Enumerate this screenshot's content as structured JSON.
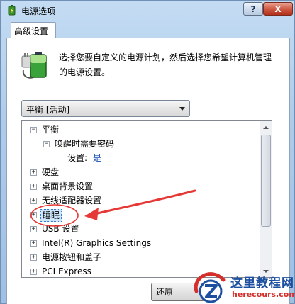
{
  "window": {
    "title": "电源选项",
    "help_label": "?",
    "close_label": "X"
  },
  "tabs": [
    {
      "label": "高级设置"
    }
  ],
  "description": "选择您要自定义的电源计划，然后选择您希望计算机管理的电源设置。",
  "plan_select": {
    "selected": "平衡 [活动]"
  },
  "tree": {
    "rows": [
      {
        "expander": "−",
        "label": "平衡"
      },
      {
        "expander": "−",
        "label": "唤醒时需要密码"
      },
      {
        "label": "设置:",
        "value": "是"
      },
      {
        "expander": "+",
        "label": "硬盘"
      },
      {
        "expander": "+",
        "label": "桌面背景设置"
      },
      {
        "expander": "+",
        "label": "无线适配器设置"
      },
      {
        "expander": "+",
        "label": "睡眠"
      },
      {
        "expander": "+",
        "label": "USB 设置"
      },
      {
        "expander": "+",
        "label": "Intel(R) Graphics Settings"
      },
      {
        "expander": "+",
        "label": "电源按钮和盖子"
      },
      {
        "expander": "+",
        "label": "PCI Express"
      }
    ]
  },
  "buttons": {
    "restore_label": "还原"
  },
  "watermark": {
    "name": "这里教程网",
    "url": "herecours.com"
  },
  "colors": {
    "annotation_red": "#e53935",
    "link_blue": "#1a4fb3",
    "selection_bg": "#cde6fb"
  },
  "icons": {
    "app": "power-options-icon",
    "battery": "battery-plug-icon"
  }
}
